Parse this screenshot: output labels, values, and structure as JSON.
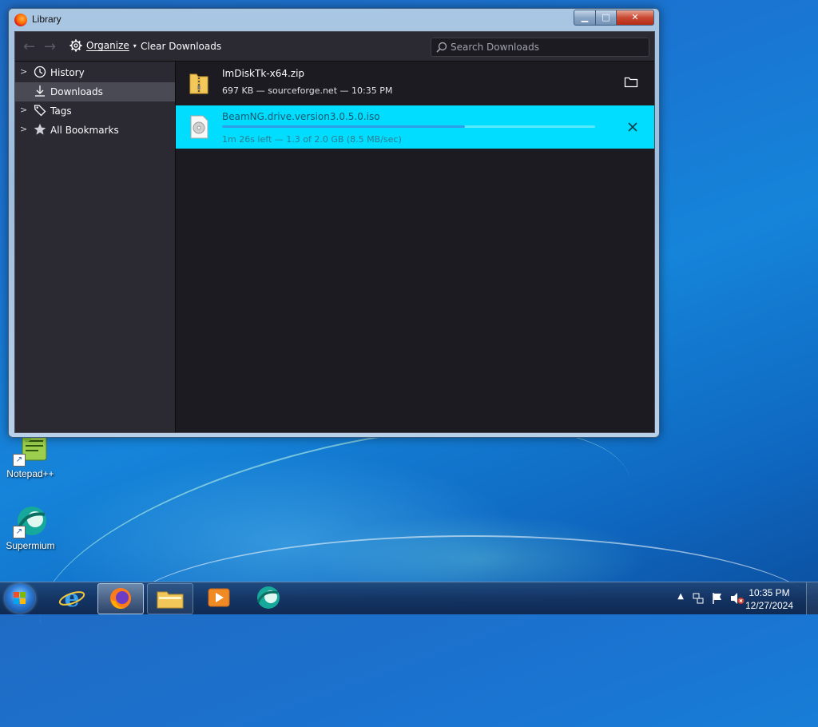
{
  "window": {
    "title": "Library",
    "controls": {
      "minimize": "▁",
      "maximize": "□",
      "close": "✕"
    }
  },
  "toolbar": {
    "back_icon": "back-arrow-icon",
    "forward_icon": "forward-arrow-icon",
    "organize_label": "Organize",
    "clear_downloads_label": "Clear Downloads",
    "search_placeholder": "Search Downloads"
  },
  "sidebar": {
    "items": [
      {
        "label": "History",
        "icon": "clock-icon",
        "twisty": ">",
        "selected": false
      },
      {
        "label": "Downloads",
        "icon": "download-icon",
        "twisty": "",
        "selected": true
      },
      {
        "label": "Tags",
        "icon": "tag-icon",
        "twisty": ">",
        "selected": false
      },
      {
        "label": "All Bookmarks",
        "icon": "star-icon",
        "twisty": ">",
        "selected": false
      }
    ]
  },
  "downloads": [
    {
      "name": "ImDiskTk-x64.zip",
      "status": "697 KB — sourceforge.net — 10:35 PM",
      "icon": "zip-folder-icon",
      "action": "open-folder",
      "active": false
    },
    {
      "name": "BeamNG.drive.version3.0.5.0.iso",
      "status": "1m 26s left — 1.3 of 2.0 GB (8.5 MB/sec)",
      "icon": "disc-image-icon",
      "action": "cancel",
      "progress": 0.65,
      "active": true
    }
  ],
  "desktop": {
    "icons": [
      {
        "label": "Notepad++"
      },
      {
        "label": "Supermium"
      }
    ]
  },
  "taskbar": {
    "clock_time": "10:35 PM",
    "clock_date": "12/27/2024",
    "pinned": [
      "internet-explorer-icon",
      "firefox-icon",
      "file-explorer-icon",
      "media-player-icon",
      "supermium-icon"
    ]
  },
  "colors": {
    "active_row": "#00ddff",
    "progress_fill": "#2f9ee8",
    "dark_bg": "#1c1b22",
    "toolbar_bg": "#2b2a33"
  }
}
